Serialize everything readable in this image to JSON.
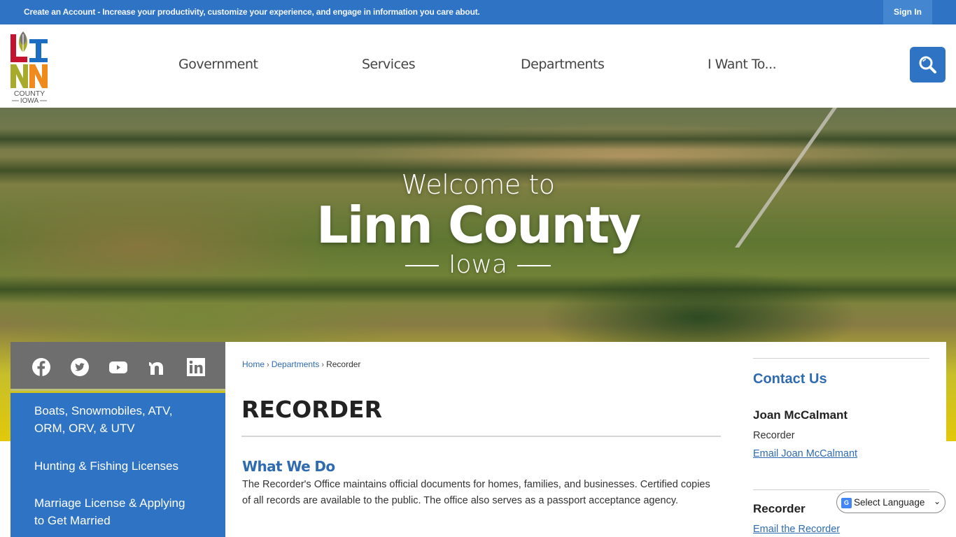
{
  "topbar": {
    "promo": "Create an Account - Increase your productivity, customize your experience, and engage in information you care about.",
    "sign_in": "Sign In"
  },
  "header": {
    "logo": {
      "line1": "LI",
      "line2": "NN",
      "county": "COUNTY",
      "state": "IOWA"
    },
    "nav": [
      "Government",
      "Services",
      "Departments",
      "I Want To..."
    ],
    "search_icon": "search-icon"
  },
  "hero": {
    "welcome": "Welcome to",
    "title": "Linn County",
    "subtitle": "Iowa"
  },
  "social": [
    "facebook-icon",
    "twitter-icon",
    "youtube-icon",
    "nextdoor-icon",
    "linkedin-icon"
  ],
  "quick_links": [
    "Boats, Snowmobiles, ATV, ORM, ORV, & UTV",
    "Hunting & Fishing Licenses",
    "Marriage License & Applying to Get Married"
  ],
  "breadcrumb": {
    "items": [
      "Home",
      "Departments"
    ],
    "current": "Recorder",
    "separator": "›"
  },
  "main": {
    "title": "RECORDER",
    "section_heading": "What We Do",
    "body": "The Recorder's Office maintains official documents for homes, families, and businesses. Certified copies of all records are available to the public. The office also serves as a passport acceptance agency."
  },
  "contact": {
    "heading": "Contact Us",
    "name": "Joan McCalmant",
    "role": "Recorder",
    "email_label": "Email Joan McCalmant",
    "office_heading": "Recorder",
    "office_email_label": "Email the Recorder"
  },
  "translate": {
    "label": "Select Language"
  },
  "colors": {
    "brand_blue": "#2f73c4",
    "link_blue": "#2f6bb1",
    "social_gray": "#6e6e6e",
    "logo_red": "#c4122f",
    "logo_blue": "#1b6ec2",
    "logo_olive": "#a8aa2b",
    "logo_orange": "#f08a1c"
  }
}
